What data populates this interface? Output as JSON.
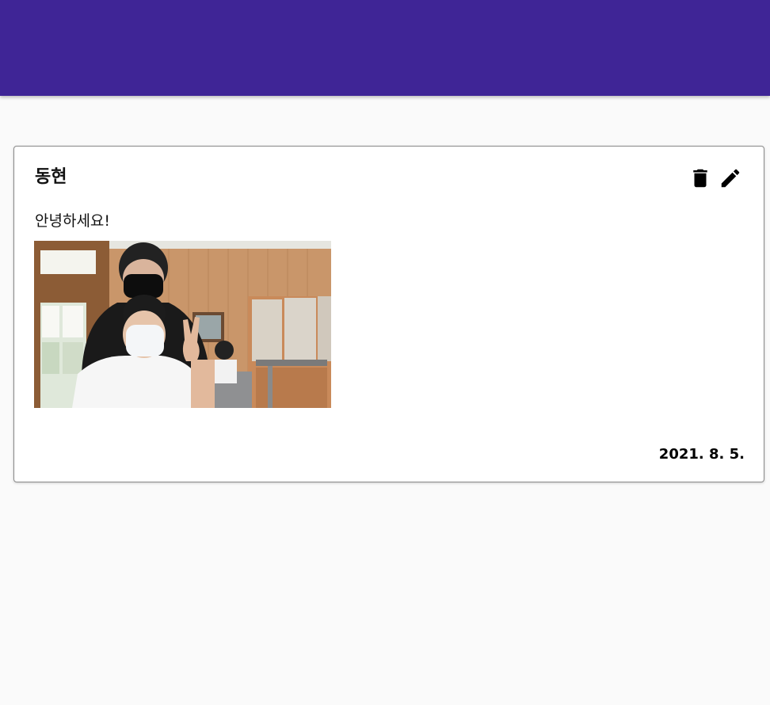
{
  "theme": {
    "accent": "#3f2596",
    "background": "#fafafa",
    "card_background": "#ffffff"
  },
  "post": {
    "author": "동현",
    "message": "안녕하세요!",
    "date": "2021. 8. 5.",
    "delete_icon": "trash-icon",
    "edit_icon": "pencil-icon",
    "photo_icon": "photo-of-two-students-in-classroom"
  }
}
